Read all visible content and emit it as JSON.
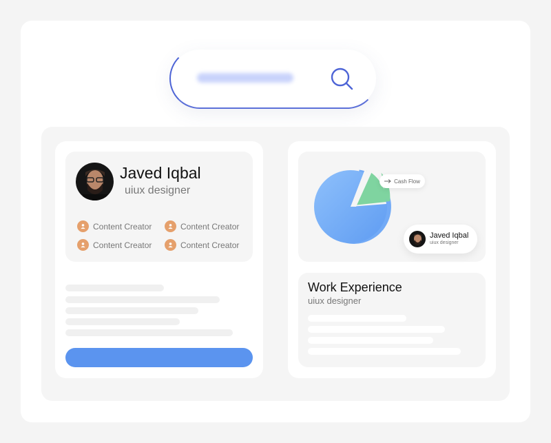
{
  "search": {
    "icon": "search-icon",
    "accent": "#4d64d6"
  },
  "profile": {
    "name": "Javed Iqbal",
    "role": "uiux designer",
    "tags": [
      "Content Creator",
      "Content Creator",
      "Content Creator",
      "Content Creator"
    ],
    "tag_icon": "user-icon",
    "tag_color": "#e5a06c",
    "button_color": "#5b94ef"
  },
  "chart_card": {
    "cash_flow_label": "Cash Flow",
    "user_name": "Javed Iqbal",
    "user_role": "uiux designer",
    "pie_colors": [
      "#6fa8f7",
      "#7fd4a0"
    ]
  },
  "work": {
    "title": "Work Experience",
    "role": "uiux designer"
  }
}
